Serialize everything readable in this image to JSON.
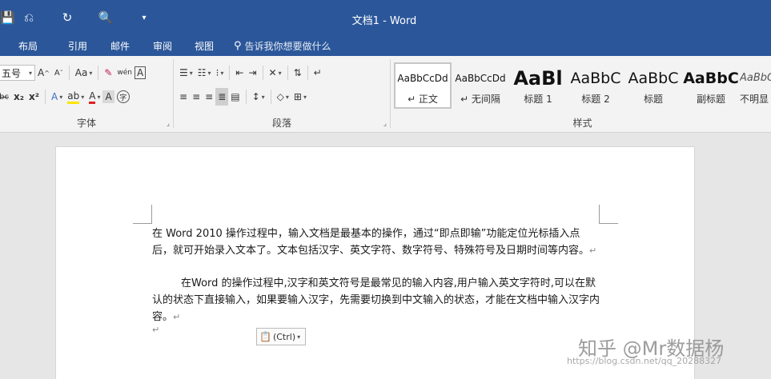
{
  "window": {
    "title": "文档1 - Word"
  },
  "qat": {
    "save_icon": "💾",
    "undo_icon": "⎌",
    "redo_icon": "↻",
    "preview_icon": "🔍",
    "more_icon": "▾"
  },
  "tabs": [
    {
      "label": "布局"
    },
    {
      "label": "引用"
    },
    {
      "label": "邮件"
    },
    {
      "label": "审阅"
    },
    {
      "label": "视图"
    }
  ],
  "tell_me": {
    "label": "告诉我你想要做什么"
  },
  "font_group": {
    "label": "字体",
    "font_size": "五号",
    "grow": "A",
    "shrink": "A",
    "change_case": "Aa",
    "pinyin": "wén",
    "border_char": "A",
    "strike": "abc",
    "subscript": "x₂",
    "superscript": "x²",
    "text_effect": "A",
    "highlight": "ab",
    "font_color": "A",
    "char_shading": "A",
    "enclose": "字"
  },
  "paragraph_group": {
    "label": "段落"
  },
  "styles_group": {
    "label": "样式",
    "items": [
      {
        "sample": "AaBbCcDd",
        "name": "↵ 正文"
      },
      {
        "sample": "AaBbCcDd",
        "name": "↵ 无间隔"
      },
      {
        "sample": "AaBl",
        "name": "标题 1"
      },
      {
        "sample": "AaBbC",
        "name": "标题 2"
      },
      {
        "sample": "AaBbC",
        "name": "标题"
      },
      {
        "sample": "AaBbC",
        "name": "副标题"
      },
      {
        "sample": "AaBbC",
        "name": "不明显"
      }
    ]
  },
  "document": {
    "para1": "在 Word 2010 操作过程中，输入文档是最基本的操作，通过“即点即输”功能定位光标插入点后，就可开始录入文本了。文本包括汉字、英文字符、数字符号、特殊符号及日期时间等内容。",
    "para2": "在Word 的操作过程中,汉字和英文符号是最常见的输入内容,用户输入英文字符时,可以在默认的状态下直接输入，如果要输入汉字，先需要切换到中文输入的状态，才能在文档中输入汉字内容。",
    "para_mark": "↵",
    "paste_options": "(Ctrl)"
  },
  "watermark": {
    "text": "知乎 @Mr数据杨",
    "url": "https://blog.csdn.net/qq_20288327"
  },
  "colors": {
    "brand": "#2b579a",
    "ribbon_bg": "#f3f3f3",
    "doc_bg": "#e6e6e6"
  }
}
